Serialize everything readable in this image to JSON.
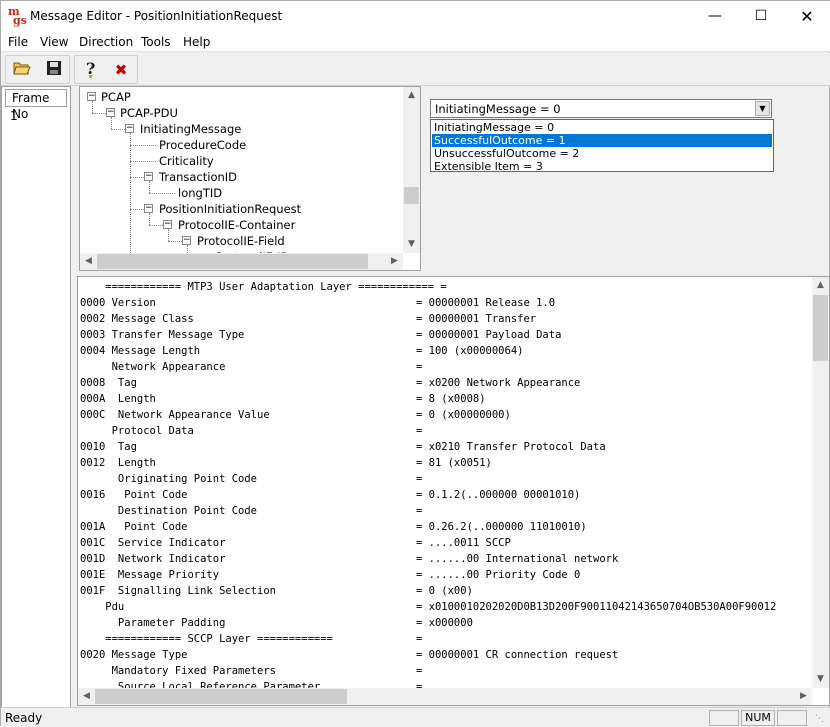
{
  "window": {
    "title": "Message Editor - PositionInitiationRequest",
    "icon_text": "mgs"
  },
  "menu": [
    "File",
    "View",
    "Direction",
    "Tools",
    "Help"
  ],
  "toolbar": {
    "icons": [
      "open-folder-icon",
      "save-icon",
      "help-icon",
      "delete-icon"
    ]
  },
  "frames": {
    "header": "Frame No",
    "rows": [
      "1"
    ]
  },
  "tree": {
    "nodes": [
      {
        "label": "PCAP",
        "expand": "−"
      },
      {
        "label": "PCAP-PDU",
        "expand": "−"
      },
      {
        "label": "InitiatingMessage",
        "expand": "−"
      },
      {
        "label": "ProcedureCode",
        "expand": ""
      },
      {
        "label": "Criticality",
        "expand": ""
      },
      {
        "label": "TransactionID",
        "expand": "−"
      },
      {
        "label": "longTID",
        "expand": ""
      },
      {
        "label": "PositionInitiationRequest",
        "expand": "−"
      },
      {
        "label": "ProtocolIE-Container",
        "expand": "−"
      },
      {
        "label": "ProtocolIE-Field",
        "expand": "−"
      },
      {
        "label": "ProtocolIE-ID",
        "expand": ""
      }
    ]
  },
  "combo": {
    "value": "InitiatingMessage = 0",
    "options": [
      {
        "label": "InitiatingMessage = 0",
        "selected": false
      },
      {
        "label": "SuccessfulOutcome = 1",
        "selected": true
      },
      {
        "label": "UnsuccessfulOutcome = 2",
        "selected": false
      },
      {
        "label": "Extensible Item = 3",
        "selected": false
      }
    ]
  },
  "dump": [
    {
      "left": "    ============ MTP3 User Adaptation Layer ============ =",
      "right": ""
    },
    {
      "left": "0000 Version",
      "right": "= 00000001 Release 1.0"
    },
    {
      "left": "0002 Message Class",
      "right": "= 00000001 Transfer"
    },
    {
      "left": "0003 Transfer Message Type",
      "right": "= 00000001 Payload Data"
    },
    {
      "left": "0004 Message Length",
      "right": "= 100 (x00000064)"
    },
    {
      "left": "     Network Appearance",
      "right": "="
    },
    {
      "left": "0008  Tag",
      "right": "= x0200 Network Appearance"
    },
    {
      "left": "000A  Length",
      "right": "= 8 (x0008)"
    },
    {
      "left": "000C  Network Appearance Value",
      "right": "= 0 (x00000000)"
    },
    {
      "left": "     Protocol Data",
      "right": "="
    },
    {
      "left": "0010  Tag",
      "right": "= x0210 Transfer Protocol Data"
    },
    {
      "left": "0012  Length",
      "right": "= 81 (x0051)"
    },
    {
      "left": "      Originating Point Code",
      "right": "="
    },
    {
      "left": "0016   Point Code",
      "right": "= 0.1.2(..000000 00001010)"
    },
    {
      "left": "      Destination Point Code",
      "right": "="
    },
    {
      "left": "001A   Point Code",
      "right": "= 0.26.2(..000000 11010010)"
    },
    {
      "left": "001C  Service Indicator",
      "right": "= ....0011 SCCP"
    },
    {
      "left": "001D  Network Indicator",
      "right": "= ......00 International network"
    },
    {
      "left": "001E  Message Priority",
      "right": "= ......00 Priority Code 0"
    },
    {
      "left": "001F  Signalling Link Selection",
      "right": "= 0 (x00)"
    },
    {
      "left": "    Pdu",
      "right": "= x0100010202020D0B13D200F90011042143650704OB530A00F90012"
    },
    {
      "left": "      Parameter Padding",
      "right": "= x000000"
    },
    {
      "left": "    ============ SCCP Layer ============",
      "right": "="
    },
    {
      "left": "0020 Message Type",
      "right": "= 00000001 CR connection request"
    },
    {
      "left": "     Mandatory Fixed Parameters",
      "right": "="
    },
    {
      "left": "      Source Local Reference Parameter",
      "right": "="
    }
  ],
  "status": {
    "text": "Ready",
    "num": "NUM"
  }
}
